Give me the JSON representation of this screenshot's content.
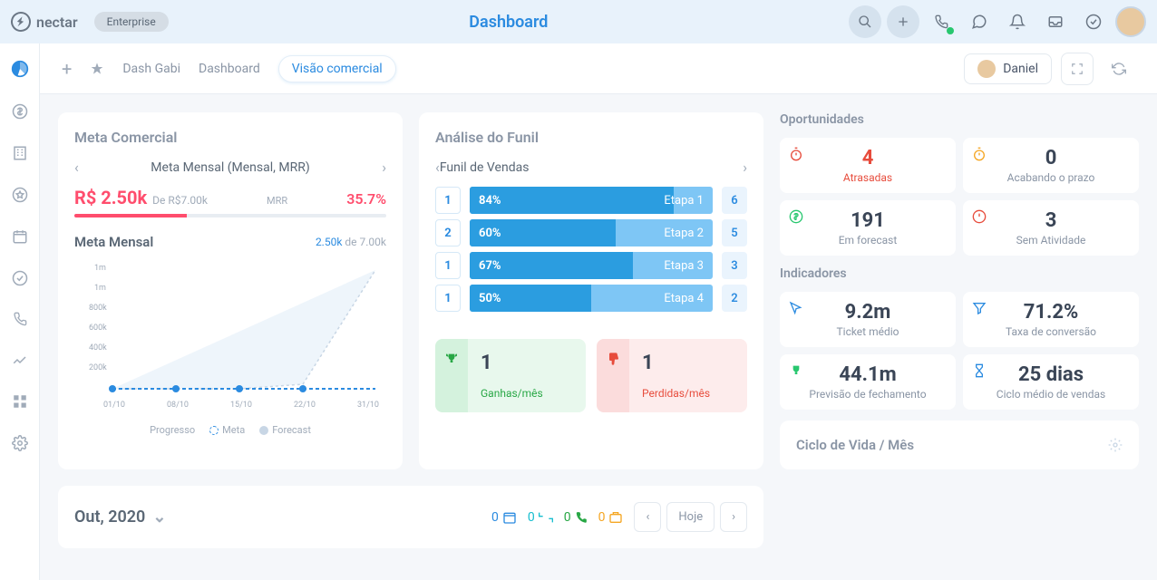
{
  "app": {
    "name": "nectar",
    "badge": "Enterprise",
    "title": "Dashboard"
  },
  "tabs": {
    "items": [
      "Dash Gabi",
      "Dashboard",
      "Visão comercial"
    ],
    "active": 2,
    "user": "Daniel"
  },
  "meta": {
    "card_title": "Meta Comercial",
    "subtitle": "Meta Mensal (Mensal, MRR)",
    "value": "R$ 2.50k",
    "target": "De R$7.00k",
    "mrr_label": "MRR",
    "pct": "35.7%",
    "chart_title": "Meta Mensal",
    "chart_val": "2.50k",
    "chart_target": "de 7.00k",
    "legend": [
      "Progresso",
      "Meta",
      "Forecast"
    ]
  },
  "funnel": {
    "card_title": "Análise do Funil",
    "subtitle": "Funil de Vendas",
    "rows": [
      {
        "left": "1",
        "pct": "84%",
        "label": "Etapa 1",
        "count": "6",
        "fill": 84
      },
      {
        "left": "2",
        "pct": "60%",
        "label": "Etapa 2",
        "count": "5",
        "fill": 60
      },
      {
        "left": "1",
        "pct": "67%",
        "label": "Etapa 3",
        "count": "3",
        "fill": 67
      },
      {
        "left": "1",
        "pct": "50%",
        "label": "Etapa 4",
        "count": "2",
        "fill": 50
      }
    ],
    "won": {
      "value": "1",
      "label": "Ganhas/mês"
    },
    "lost": {
      "value": "1",
      "label": "Perdidas/mês"
    }
  },
  "opps": {
    "title": "Oportunidades",
    "cards": [
      {
        "value": "4",
        "label": "Atrasadas",
        "style": "red",
        "icon": "stopwatch"
      },
      {
        "value": "0",
        "label": "Acabando o prazo",
        "style": "",
        "icon": "stopwatch-o"
      },
      {
        "value": "191",
        "label": "Em forecast",
        "style": "",
        "icon": "dollar"
      },
      {
        "value": "3",
        "label": "Sem Atividade",
        "style": "",
        "icon": "alert"
      }
    ]
  },
  "ind": {
    "title": "Indicadores",
    "cards": [
      {
        "value": "9.2m",
        "label": "Ticket médio",
        "icon": "cursor"
      },
      {
        "value": "71.2%",
        "label": "Taxa de conversão",
        "icon": "funnel"
      },
      {
        "value": "44.1m",
        "label": "Previsão de fechamento",
        "icon": "trophy"
      },
      {
        "value": "25 dias",
        "label": "Ciclo médio de vendas",
        "icon": "hourglass"
      }
    ]
  },
  "calendar": {
    "month": "Out, 2020",
    "counts": [
      "0",
      "0",
      "0",
      "0"
    ],
    "today": "Hoje"
  },
  "life": {
    "title": "Ciclo de Vida / Mês"
  },
  "chart_data": {
    "type": "line",
    "title": "Meta Mensal",
    "xlabel": "",
    "ylabel": "",
    "categories": [
      "01/10",
      "08/10",
      "15/10",
      "22/10",
      "31/10"
    ],
    "ylim": [
      0,
      1000000
    ],
    "yticks": [
      "1m",
      "1m",
      "800k",
      "600k",
      "400k",
      "200k"
    ],
    "series": [
      {
        "name": "Progresso",
        "values": [
          0,
          0,
          0,
          0,
          0
        ]
      },
      {
        "name": "Meta",
        "values": [
          0,
          0,
          0,
          0,
          0
        ]
      },
      {
        "name": "Forecast",
        "values": [
          0,
          0,
          0,
          50000,
          1000000
        ]
      }
    ]
  }
}
